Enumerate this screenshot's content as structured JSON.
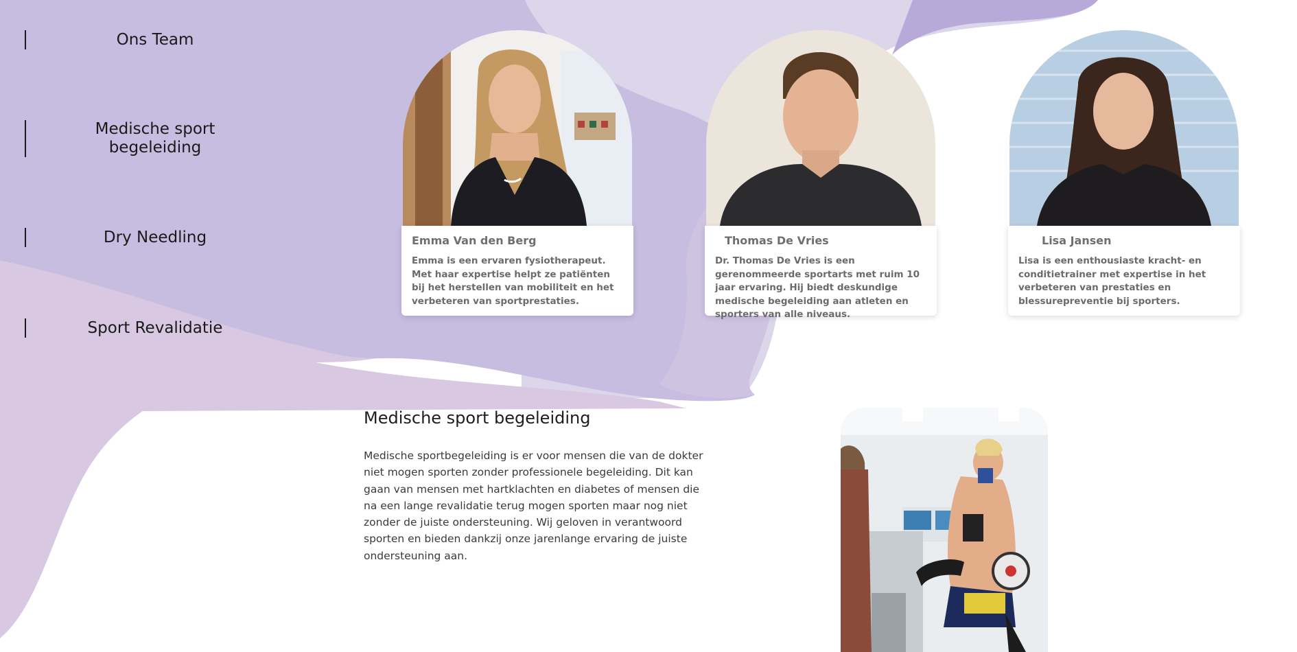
{
  "sidebar": {
    "items": [
      {
        "label": "Ons Team"
      },
      {
        "label": "Medische sport begeleiding"
      },
      {
        "label": "Dry Needling"
      },
      {
        "label": "Sport Revalidatie"
      }
    ]
  },
  "team": {
    "members": [
      {
        "name": "Emma Van den Berg",
        "bio": "Emma is een ervaren fysiotherapeut. Met haar expertise helpt ze patiënten bij het herstellen van mobiliteit en het verbeteren van sportprestaties."
      },
      {
        "name": "Thomas De Vries",
        "bio": "Dr. Thomas De Vries is een gerenommeerde sportarts met ruim 10 jaar ervaring. Hij biedt deskundige medische begeleiding aan atleten en sporters van alle niveaus."
      },
      {
        "name": "Lisa Jansen",
        "bio": "Lisa is een enthousiaste kracht- en conditietrainer met expertise in het verbeteren van prestaties en blessurepreventie bij sporters."
      }
    ]
  },
  "section": {
    "title": "Medische sport begeleiding",
    "text": "Medische sportbegeleiding is er voor mensen die van de dokter niet mogen sporten zonder professionele begeleiding. Dit kan gaan van mensen met hartklachten en diabetes of mensen die na een lange revalidatie terug mogen sporten maar nog niet zonder de juiste ondersteuning. Wij geloven in verantwoord sporten en bieden dankzij onze jarenlange ervaring de juiste ondersteuning aan."
  },
  "colors": {
    "blob_main": "#c6bde0",
    "blob_light": "#dcd6eb",
    "blob_pink": "#d8c8e2",
    "blob_accent": "#b7aad8"
  }
}
